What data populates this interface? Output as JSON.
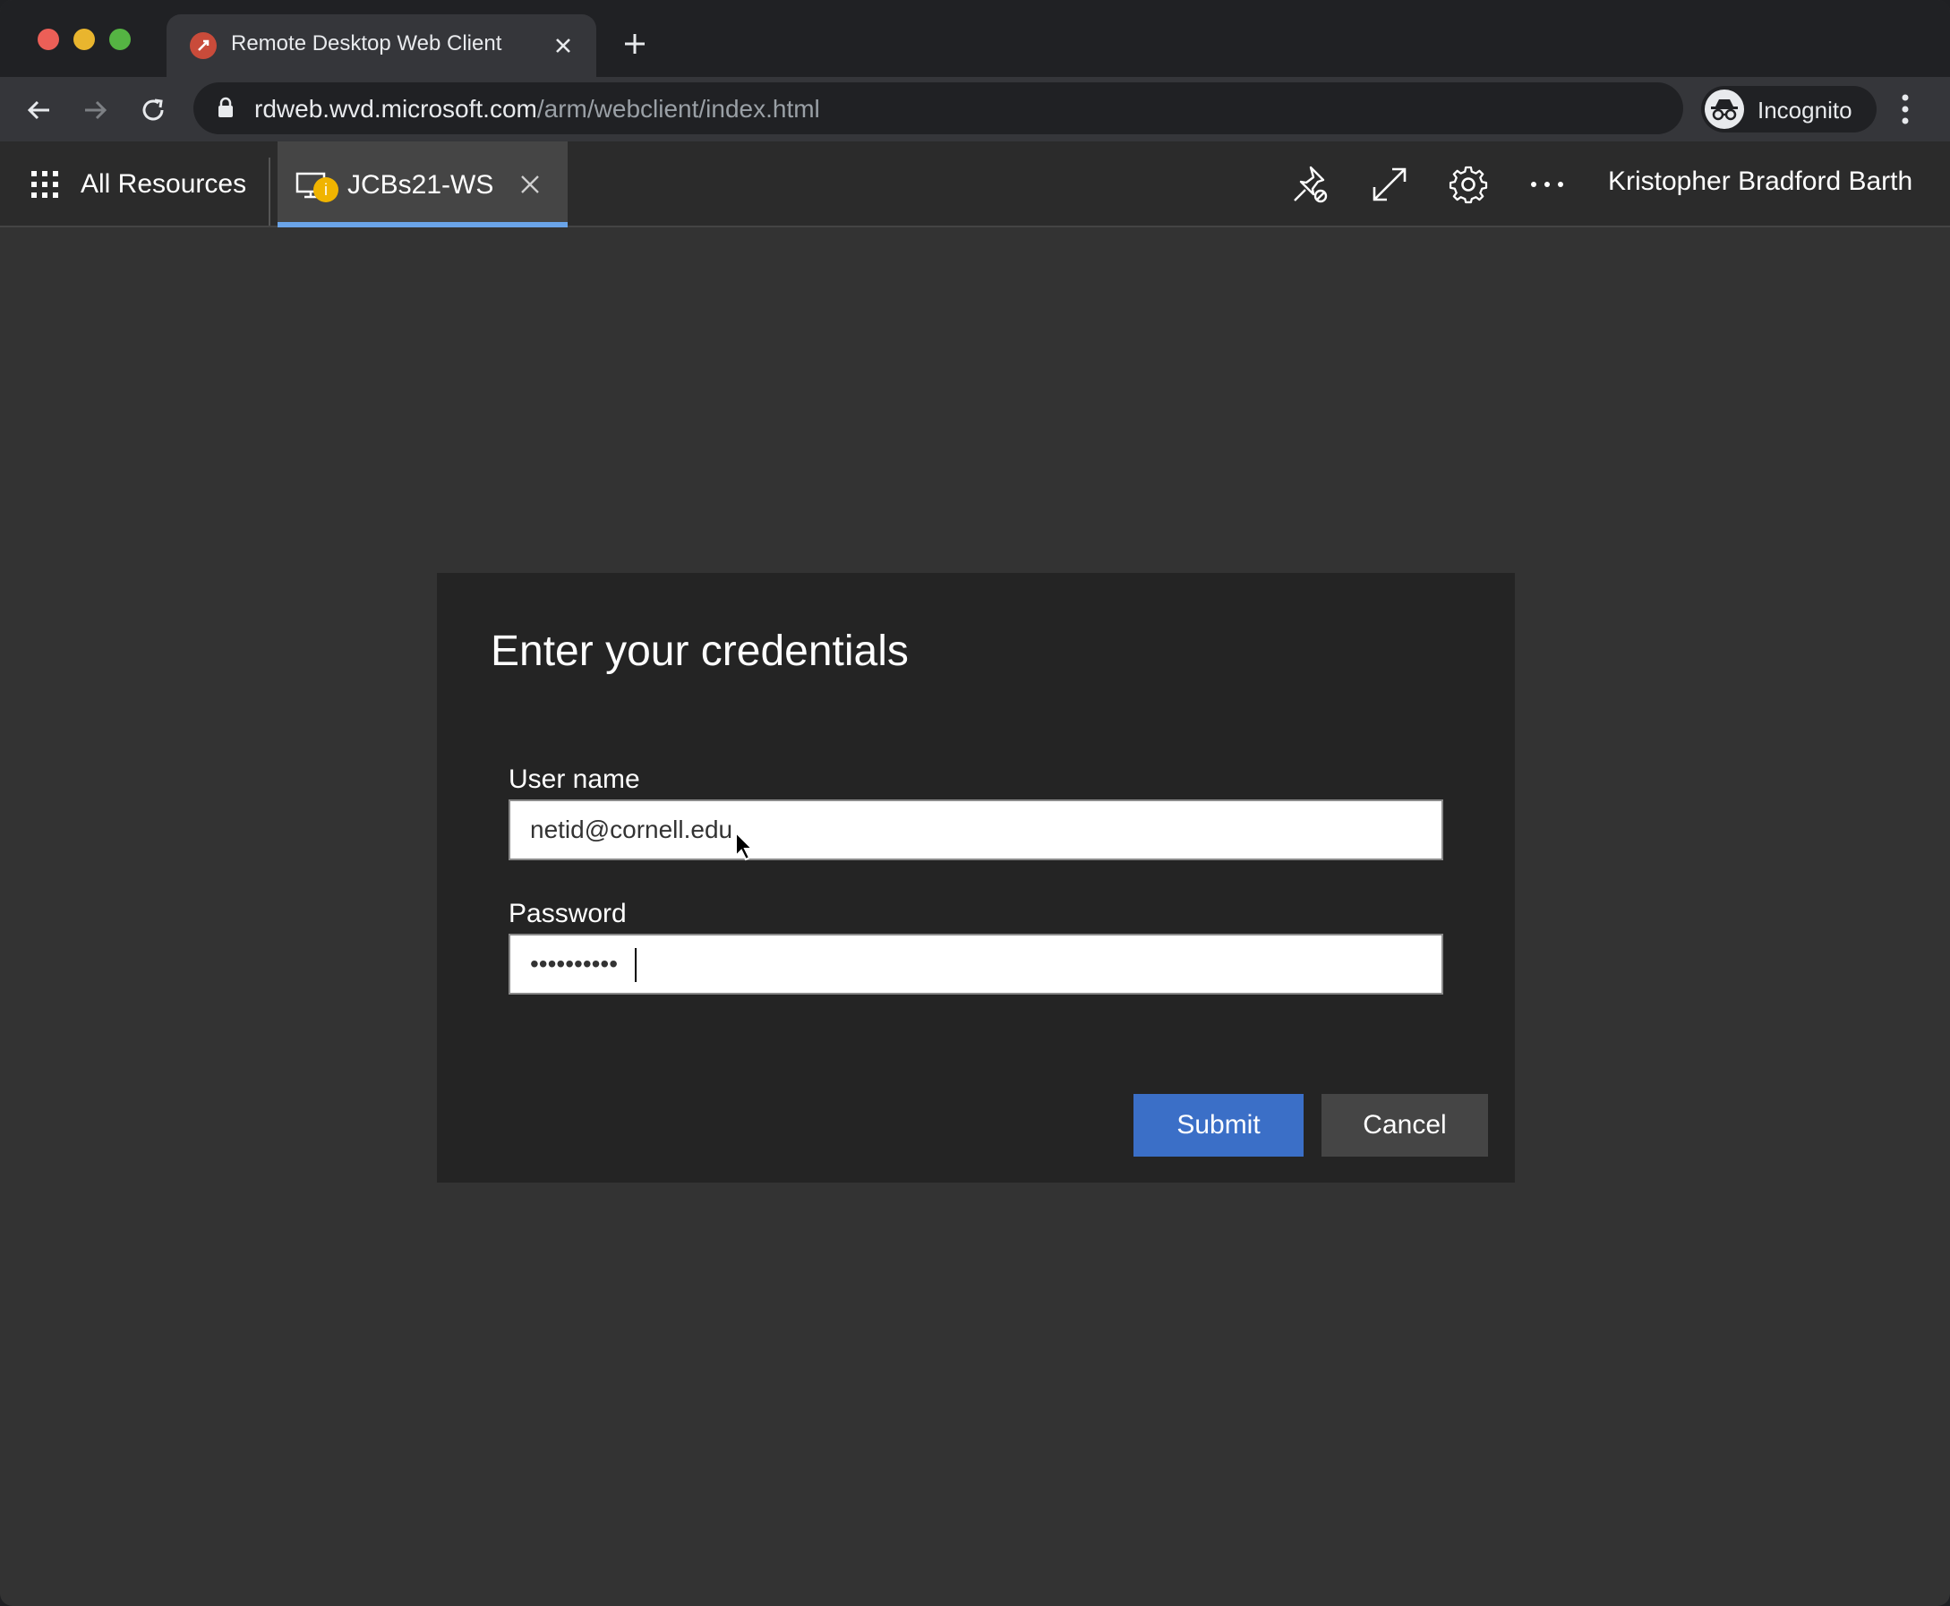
{
  "browser": {
    "tab_title": "Remote Desktop Web Client",
    "url_host": "rdweb.wvd.microsoft.com",
    "url_path": "/arm/webclient/index.html",
    "profile_label": "Incognito"
  },
  "rd_bar": {
    "all_resources_label": "All Resources",
    "session_tab_label": "JCBs21-WS",
    "session_badge": "i",
    "user_name": "Kristopher Bradford Barth",
    "accent_color": "#6aa4e8"
  },
  "dialog": {
    "title": "Enter your credentials",
    "username_label": "User name",
    "username_value": "netid@cornell.edu",
    "password_label": "Password",
    "password_value": "••••••••••",
    "submit_label": "Submit",
    "cancel_label": "Cancel",
    "submit_color": "#3b6fc7"
  }
}
